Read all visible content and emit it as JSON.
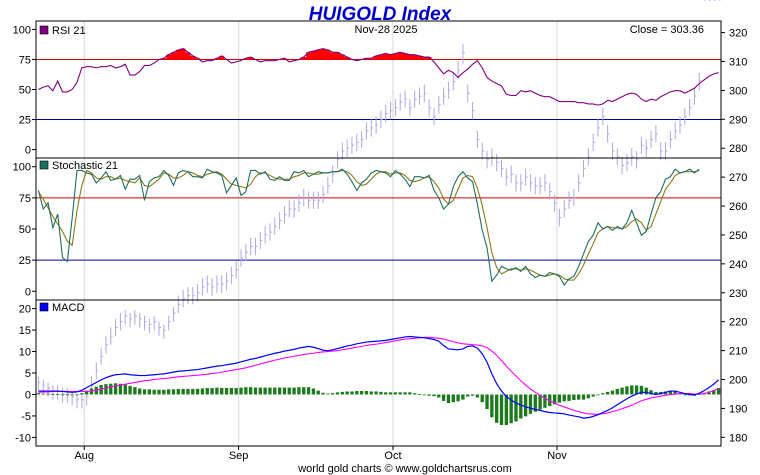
{
  "chart_data": {
    "type": "line",
    "title": "HUIGOLD Index",
    "date": "Nov-28  2025",
    "close_label": "Close = 303.36",
    "footer": "world gold charts © www.goldchartsrus.com",
    "x_labels": [
      "Aug",
      "Sep",
      "Oct",
      "Nov"
    ],
    "month_start_index": [
      10,
      42,
      74,
      108
    ],
    "bars": 142,
    "colors": {
      "title": "#0000cc",
      "price": "#b0a6e8",
      "rsi": "#800080",
      "stoch_k": "#1f6e5e",
      "stoch_d": "#8a7a1a",
      "macd": "#0000ff",
      "signal": "#ff00ff",
      "hist": "#1b7a1b",
      "high_line": "#cc0000",
      "low_line": "#000099",
      "rsi_fill": "#ff0000"
    },
    "price_axis": {
      "ticks": [
        180,
        190,
        200,
        210,
        220,
        230,
        240,
        250,
        260,
        270,
        280,
        290,
        300,
        310,
        320
      ],
      "ylim": [
        177,
        324
      ]
    },
    "price_series": {
      "name": "HUIGOLD",
      "close": [
        199,
        198,
        197,
        196,
        196,
        195,
        195,
        194,
        193,
        193,
        194,
        198,
        203,
        208,
        212,
        215,
        218,
        220,
        222,
        221,
        222,
        221,
        220,
        219,
        220,
        218,
        217,
        220,
        223,
        226,
        228,
        229,
        229,
        230,
        232,
        233,
        232,
        233,
        233,
        234,
        236,
        238,
        242,
        244,
        246,
        246,
        248,
        250,
        251,
        253,
        255,
        257,
        259,
        259,
        261,
        263,
        262,
        262,
        262,
        264,
        267,
        271,
        276,
        279,
        280,
        281,
        282,
        283,
        286,
        287,
        288,
        290,
        292,
        293,
        294,
        296,
        297,
        294,
        297,
        298,
        299,
        294,
        291,
        295,
        298,
        300,
        303,
        307,
        313,
        299,
        293,
        283,
        279,
        276,
        277,
        275,
        273,
        270,
        271,
        268,
        268,
        270,
        268,
        267,
        267,
        268,
        265,
        261,
        256,
        259,
        262,
        263,
        268,
        273,
        277,
        282,
        287,
        291,
        285,
        279,
        277,
        274,
        275,
        277,
        276,
        281,
        280,
        283,
        285,
        279,
        279,
        283,
        286,
        288,
        291,
        294,
        298,
        303.36
      ],
      "high": [
        201,
        200,
        199,
        198,
        198,
        197,
        197,
        196,
        195,
        195,
        196,
        201,
        206,
        211,
        215,
        218,
        221,
        223,
        224,
        223,
        224,
        223,
        222,
        221,
        222,
        220,
        219,
        222,
        225,
        229,
        231,
        232,
        232,
        233,
        235,
        236,
        235,
        236,
        236,
        237,
        239,
        241,
        245,
        247,
        249,
        249,
        251,
        253,
        254,
        256,
        258,
        260,
        262,
        262,
        264,
        266,
        265,
        265,
        265,
        267,
        270,
        274,
        279,
        282,
        283,
        284,
        285,
        286,
        289,
        290,
        291,
        293,
        295,
        296,
        297,
        299,
        300,
        297,
        300,
        301,
        302,
        297,
        294,
        298,
        301,
        303,
        306,
        310,
        316,
        302,
        296,
        286,
        282,
        279,
        280,
        278,
        276,
        273,
        274,
        271,
        271,
        273,
        271,
        270,
        270,
        271,
        268,
        264,
        259,
        262,
        265,
        266,
        271,
        276,
        280,
        285,
        290,
        294,
        288,
        282,
        280,
        277,
        278,
        280,
        279,
        284,
        283,
        286,
        288,
        282,
        282,
        286,
        289,
        291,
        294,
        297,
        301,
        306
      ],
      "low": [
        196,
        195,
        194,
        193,
        193,
        192,
        192,
        191,
        190,
        190,
        191,
        195,
        200,
        205,
        209,
        212,
        215,
        217,
        219,
        218,
        219,
        218,
        217,
        216,
        217,
        215,
        214,
        217,
        220,
        223,
        225,
        226,
        226,
        227,
        229,
        230,
        229,
        230,
        230,
        231,
        233,
        235,
        239,
        241,
        243,
        243,
        245,
        247,
        248,
        250,
        252,
        254,
        256,
        256,
        258,
        260,
        259,
        259,
        259,
        261,
        264,
        268,
        273,
        276,
        277,
        278,
        279,
        280,
        283,
        284,
        285,
        287,
        289,
        290,
        291,
        293,
        294,
        291,
        294,
        295,
        296,
        291,
        288,
        292,
        295,
        297,
        300,
        304,
        309,
        296,
        290,
        280,
        276,
        273,
        274,
        272,
        270,
        267,
        268,
        265,
        265,
        267,
        265,
        264,
        264,
        265,
        262,
        258,
        253,
        256,
        259,
        260,
        265,
        270,
        274,
        279,
        284,
        288,
        282,
        276,
        274,
        271,
        272,
        274,
        273,
        278,
        277,
        280,
        282,
        276,
        276,
        280,
        283,
        285,
        288,
        291,
        295,
        300
      ]
    },
    "rsi_panel": {
      "label": "RSI 21",
      "y_ticks": [
        0,
        25,
        50,
        75,
        100
      ],
      "ylim": [
        -7,
        107
      ],
      "levels": [
        75,
        25
      ],
      "values": [
        50,
        52,
        53,
        49,
        57,
        48,
        48,
        50,
        56,
        68,
        69,
        69,
        68,
        69,
        69,
        70,
        68,
        69,
        71,
        62,
        62,
        65,
        70,
        70,
        72,
        75,
        76,
        79,
        81,
        83,
        84,
        81,
        78,
        76,
        73,
        74,
        74,
        76,
        78,
        75,
        72,
        73,
        74,
        76,
        77,
        75,
        73,
        74,
        74,
        74,
        75,
        76,
        73,
        74,
        75,
        77,
        81,
        82,
        83,
        84,
        83,
        81,
        81,
        79,
        77,
        75,
        74,
        75,
        76,
        76,
        78,
        79,
        80,
        79,
        80,
        81,
        80,
        79,
        79,
        78,
        77,
        77,
        73,
        68,
        63,
        66,
        64,
        60,
        64,
        67,
        71,
        74,
        68,
        60,
        57,
        55,
        53,
        46,
        45,
        45,
        49,
        48,
        49,
        47,
        45,
        44,
        44,
        42,
        40,
        40,
        40,
        40,
        39,
        39,
        38,
        38,
        37,
        38,
        41,
        40,
        42,
        44,
        46,
        47,
        46,
        42,
        40,
        42,
        41,
        44,
        46,
        48,
        49,
        49,
        47,
        49,
        51,
        55,
        58,
        61,
        63,
        64
      ]
    },
    "stochastic_panel": {
      "label": "Stochastic 21",
      "y_ticks": [
        0,
        25,
        50,
        75,
        100
      ],
      "ylim": [
        -7,
        107
      ],
      "levels": [
        75,
        25
      ],
      "k": [
        81,
        66,
        71,
        51,
        62,
        27,
        24,
        59,
        97,
        97,
        95,
        94,
        87,
        91,
        96,
        89,
        90,
        93,
        82,
        90,
        90,
        93,
        73,
        88,
        91,
        92,
        97,
        93,
        85,
        95,
        97,
        96,
        92,
        92,
        91,
        98,
        96,
        95,
        93,
        79,
        85,
        91,
        77,
        80,
        97,
        97,
        94,
        96,
        90,
        89,
        92,
        89,
        89,
        96,
        95,
        97,
        92,
        94,
        96,
        95,
        95,
        96,
        96,
        98,
        94,
        88,
        81,
        87,
        90,
        95,
        97,
        96,
        95,
        92,
        97,
        94,
        90,
        84,
        92,
        92,
        91,
        93,
        81,
        75,
        66,
        70,
        84,
        92,
        96,
        91,
        88,
        70,
        49,
        35,
        8,
        13,
        20,
        18,
        17,
        19,
        16,
        20,
        14,
        11,
        13,
        12,
        15,
        14,
        12,
        5,
        10,
        12,
        20,
        30,
        40,
        45,
        55,
        50,
        52,
        49,
        52,
        50,
        55,
        65,
        55,
        45,
        48,
        62,
        75,
        80,
        90,
        92,
        98,
        95,
        96,
        98,
        95,
        98
      ],
      "d": [
        80,
        74,
        67,
        60,
        54,
        48,
        40,
        37,
        65,
        85,
        97,
        95,
        91,
        90,
        92,
        92,
        90,
        91,
        89,
        88,
        87,
        91,
        85,
        84,
        87,
        90,
        95,
        94,
        91,
        91,
        93,
        96,
        95,
        93,
        92,
        94,
        95,
        96,
        94,
        90,
        86,
        85,
        84,
        83,
        86,
        92,
        95,
        95,
        93,
        91,
        90,
        90,
        90,
        92,
        93,
        95,
        95,
        94,
        94,
        95,
        95,
        96,
        96,
        97,
        96,
        93,
        88,
        85,
        86,
        90,
        94,
        96,
        96,
        94,
        95,
        95,
        93,
        89,
        88,
        89,
        91,
        92,
        88,
        83,
        74,
        70,
        73,
        82,
        91,
        93,
        92,
        83,
        69,
        51,
        31,
        19,
        14,
        16,
        18,
        18,
        17,
        18,
        17,
        15,
        13,
        12,
        13,
        14,
        13,
        10,
        9,
        9,
        14,
        21,
        30,
        38,
        47,
        50,
        52,
        51,
        51,
        50,
        52,
        56,
        58,
        55,
        49,
        52,
        62,
        72,
        82,
        87,
        93,
        95,
        96,
        96,
        96,
        97
      ]
    },
    "macd_panel": {
      "label": "MACD",
      "y_ticks": [
        -10,
        -5,
        0,
        5,
        10,
        15,
        20
      ],
      "ylim": [
        -12,
        22
      ],
      "macd": [
        0.8,
        0.8,
        0.8,
        0.8,
        0.8,
        0.7,
        0.6,
        0.5,
        0.6,
        1.0,
        1.6,
        2.2,
        2.8,
        3.4,
        3.9,
        4.3,
        4.6,
        4.7,
        4.8,
        4.6,
        4.5,
        4.4,
        4.4,
        4.5,
        4.6,
        4.7,
        4.8,
        5.0,
        5.2,
        5.4,
        5.5,
        5.6,
        5.7,
        5.8,
        6.0,
        6.2,
        6.4,
        6.6,
        6.7,
        6.9,
        7.1,
        7.3,
        7.6,
        7.9,
        8.2,
        8.4,
        8.7,
        9.0,
        9.3,
        9.6,
        9.8,
        10.1,
        10.3,
        10.5,
        10.8,
        11.0,
        11.2,
        11.0,
        10.7,
        10.3,
        10.2,
        10.4,
        10.7,
        11.0,
        11.3,
        11.5,
        11.8,
        12.0,
        12.2,
        12.3,
        12.4,
        12.5,
        12.6,
        12.8,
        13.0,
        13.2,
        13.4,
        13.5,
        13.4,
        13.3,
        13.2,
        13.0,
        12.8,
        12.4,
        11.4,
        10.6,
        10.5,
        10.4,
        10.6,
        11.2,
        11.3,
        10.8,
        9.5,
        7.5,
        4.8,
        2.5,
        0.8,
        -0.5,
        -1.3,
        -2.0,
        -2.4,
        -2.9,
        -3.2,
        -3.5,
        -3.7,
        -4.0,
        -4.2,
        -4.3,
        -4.4,
        -4.5,
        -4.8,
        -5.0,
        -5.2,
        -5.5,
        -5.4,
        -5.1,
        -4.7,
        -4.2,
        -3.7,
        -3.1,
        -2.4,
        -1.7,
        -1.0,
        -0.4,
        0.1,
        0.5,
        0.5,
        0.2,
        0.0,
        0.2,
        0.5,
        0.8,
        0.8,
        0.5,
        0.2,
        0.0,
        -0.1,
        0.3,
        0.9,
        1.6,
        2.4,
        3.4
      ],
      "signal": [
        0.5,
        0.6,
        0.6,
        0.7,
        0.7,
        0.7,
        0.7,
        0.7,
        0.7,
        0.7,
        0.7,
        0.8,
        1.0,
        1.2,
        1.5,
        1.8,
        2.0,
        2.2,
        2.4,
        2.6,
        2.8,
        3.0,
        3.2,
        3.3,
        3.5,
        3.6,
        3.7,
        3.8,
        4.0,
        4.1,
        4.2,
        4.3,
        4.4,
        4.5,
        4.6,
        4.7,
        4.9,
        5.0,
        5.2,
        5.4,
        5.6,
        5.8,
        6.0,
        6.2,
        6.5,
        6.8,
        7.1,
        7.4,
        7.7,
        8.0,
        8.2,
        8.5,
        8.7,
        8.9,
        9.1,
        9.3,
        9.5,
        9.6,
        9.8,
        9.9,
        10.0,
        10.1,
        10.2,
        10.4,
        10.6,
        10.8,
        11.0,
        11.2,
        11.4,
        11.6,
        11.7,
        11.9,
        12.1,
        12.3,
        12.5,
        12.7,
        12.9,
        13.0,
        13.1,
        13.2,
        13.3,
        13.3,
        13.2,
        13.1,
        12.9,
        12.6,
        12.3,
        12.0,
        11.8,
        11.7,
        11.6,
        11.5,
        11.3,
        10.9,
        10.1,
        9.1,
        7.9,
        6.6,
        5.4,
        4.3,
        3.2,
        2.2,
        1.3,
        0.5,
        -0.2,
        -0.9,
        -1.5,
        -2.0,
        -2.5,
        -2.9,
        -3.3,
        -3.7,
        -4.0,
        -4.3,
        -4.5,
        -4.6,
        -4.6,
        -4.5,
        -4.3,
        -4.0,
        -3.7,
        -3.3,
        -2.9,
        -2.5,
        -2.0,
        -1.5,
        -1.1,
        -0.8,
        -0.6,
        -0.4,
        -0.2,
        0.0,
        0.1,
        0.2,
        0.2,
        0.2,
        0.1,
        0.1,
        0.2,
        0.5,
        0.9,
        1.4
      ],
      "histogram": [
        0.3,
        0.2,
        0.2,
        0.1,
        0.1,
        0.0,
        -0.1,
        -0.2,
        -0.1,
        0.3,
        0.9,
        1.4,
        1.8,
        2.2,
        2.4,
        2.5,
        2.6,
        2.5,
        2.4,
        2.0,
        1.7,
        1.4,
        1.2,
        1.2,
        1.1,
        1.1,
        1.1,
        1.2,
        1.2,
        1.3,
        1.3,
        1.3,
        1.3,
        1.3,
        1.4,
        1.5,
        1.5,
        1.6,
        1.5,
        1.5,
        1.5,
        1.5,
        1.6,
        1.7,
        1.7,
        1.6,
        1.6,
        1.6,
        1.6,
        1.6,
        1.6,
        1.6,
        1.6,
        1.6,
        1.7,
        1.7,
        1.7,
        1.4,
        0.9,
        0.4,
        0.2,
        0.3,
        0.5,
        0.6,
        0.7,
        0.7,
        0.8,
        0.8,
        0.8,
        0.7,
        0.7,
        0.6,
        0.5,
        0.5,
        0.5,
        0.5,
        0.5,
        0.5,
        0.3,
        0.1,
        -0.1,
        -0.3,
        -0.4,
        -0.7,
        -1.5,
        -2.0,
        -1.8,
        -1.6,
        -1.2,
        -0.5,
        -0.3,
        -0.7,
        -1.8,
        -3.4,
        -5.3,
        -6.6,
        -7.1,
        -7.1,
        -6.7,
        -6.3,
        -5.6,
        -5.1,
        -4.5,
        -4.0,
        -3.5,
        -3.1,
        -2.7,
        -2.3,
        -1.9,
        -1.6,
        -1.5,
        -1.3,
        -1.2,
        -1.2,
        -0.9,
        -0.5,
        -0.1,
        0.3,
        0.6,
        0.9,
        1.3,
        1.6,
        1.9,
        2.1,
        2.1,
        2.0,
        1.6,
        1.0,
        0.6,
        0.6,
        0.7,
        0.8,
        0.7,
        0.3,
        0.0,
        -0.2,
        -0.3,
        0.1,
        0.4,
        0.7,
        1.0,
        1.5
      ]
    }
  }
}
